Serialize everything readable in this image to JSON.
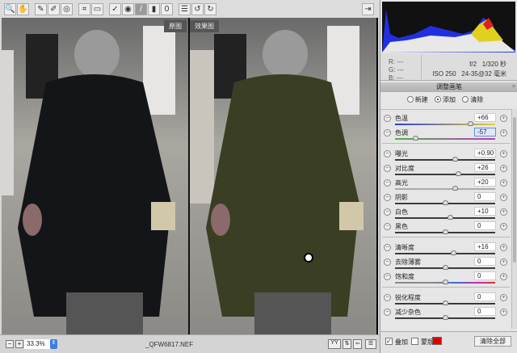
{
  "toolbar": {
    "tools": [
      {
        "icon": "zoom-icon",
        "g": "🔍"
      },
      {
        "icon": "hand-icon",
        "g": "✋"
      },
      {
        "sep": true
      },
      {
        "icon": "white-balance-icon",
        "g": "✎"
      },
      {
        "icon": "color-sampler-icon",
        "g": "✐"
      },
      {
        "icon": "targeted-adjust-icon",
        "g": "◎"
      },
      {
        "sep": true
      },
      {
        "icon": "crop-icon",
        "g": "⌗"
      },
      {
        "icon": "straighten-icon",
        "g": "▭"
      },
      {
        "sep": true
      },
      {
        "icon": "spot-removal-icon",
        "g": "✓"
      },
      {
        "icon": "red-eye-icon",
        "g": "◉"
      },
      {
        "icon": "adjustment-brush-icon",
        "g": "/",
        "on": true
      },
      {
        "icon": "graduated-filter-icon",
        "g": "▮"
      },
      {
        "icon": "radial-filter-icon",
        "g": "0"
      },
      {
        "sep": true
      },
      {
        "icon": "preferences-icon",
        "g": "☰"
      },
      {
        "icon": "rotate-left-icon",
        "g": "↺"
      },
      {
        "icon": "rotate-right-icon",
        "g": "↻"
      }
    ]
  },
  "viewer": {
    "before_label": "原图",
    "after_label": "效果图",
    "before_coat": "#141518",
    "after_coat": "#3a3e23"
  },
  "status": {
    "zoom_out": "−",
    "zoom_in": "+",
    "zoom": "33.3%",
    "filename": "_QFW6817.NEF"
  },
  "info": {
    "r": "R:",
    "g": "G:",
    "b": "B:",
    "dash": "---",
    "aperture": "f/2",
    "shutter": "1/320 秒",
    "iso": "ISO 250",
    "lens": "24-35@32 毫米"
  },
  "panel": {
    "title": "调整画笔",
    "menu": "≡",
    "mode_new": "新建",
    "mode_add": "添加",
    "mode_erase": "清除",
    "groups": [
      [
        {
          "label": "色温",
          "value": "+66",
          "pos": 0.75,
          "track": "linear-gradient(90deg,#2b3bd0,#e6d23a)"
        },
        {
          "label": "色调",
          "value": "-57",
          "pos": 0.2,
          "track": "linear-gradient(90deg,#4fb04a,#c038c0)",
          "selected": true
        }
      ],
      [
        {
          "label": "曝光",
          "value": "+0.90",
          "pos": 0.6
        },
        {
          "label": "对比度",
          "value": "+26",
          "pos": 0.63
        },
        {
          "label": "高光",
          "value": "+20",
          "pos": 0.6,
          "track": "#aaa"
        },
        {
          "label": "阴影",
          "value": "0",
          "pos": 0.5
        },
        {
          "label": "白色",
          "value": "+10",
          "pos": 0.55
        },
        {
          "label": "黑色",
          "value": "0",
          "pos": 0.5
        }
      ],
      [
        {
          "label": "清晰度",
          "value": "+16",
          "pos": 0.58
        },
        {
          "label": "去除薄雾",
          "value": "0",
          "pos": 0.5
        },
        {
          "label": "饱和度",
          "value": "0",
          "pos": 0.5,
          "track": "linear-gradient(90deg,#888 40%,#3a6cd0,#c02bb8,#e03030)"
        }
      ],
      [
        {
          "label": "锐化程度",
          "value": "0",
          "pos": 0.5
        },
        {
          "label": "减少杂色",
          "value": "0",
          "pos": 0.5
        }
      ]
    ],
    "overlay": "叠加",
    "mask": "蒙版",
    "mask_color": "#e00000",
    "clear_all": "清除全部"
  }
}
